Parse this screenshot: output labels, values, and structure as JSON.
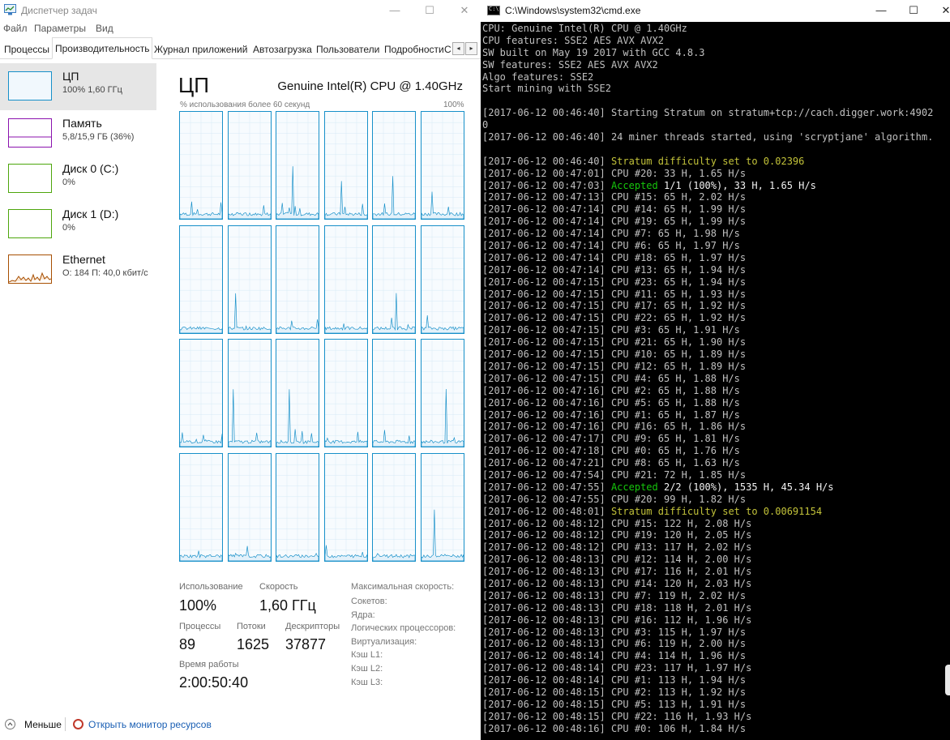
{
  "taskmanager": {
    "title": "Диспетчер задач",
    "menu": [
      "Файл",
      "Параметры",
      "Вид"
    ],
    "tabs": [
      "Процессы",
      "Производительность",
      "Журнал приложений",
      "Автозагрузка",
      "Пользователи",
      "Подробности",
      "С"
    ],
    "sidebar": [
      {
        "name": "ЦП",
        "value": "100% 1,60 ГГц",
        "color": "#1790c9"
      },
      {
        "name": "Память",
        "value": "5,8/15,9 ГБ (36%)",
        "color": "#8b12ae"
      },
      {
        "name": "Диск 0 (C:)",
        "value": "0%",
        "color": "#4da60c"
      },
      {
        "name": "Диск 1 (D:)",
        "value": "0%",
        "color": "#4da60c"
      },
      {
        "name": "Ethernet",
        "value": "О: 184 П: 40,0 кбит/с",
        "color": "#a74f01"
      }
    ],
    "cpu": {
      "title": "ЦП",
      "model": "Genuine Intel(R) CPU @ 1.40GHz",
      "graph_caption": "% использования более 60 секунд",
      "graph_max": "100%",
      "cores": 24
    },
    "stats": {
      "usage_label": "Использование",
      "usage_value": "100%",
      "speed_label": "Скорость",
      "speed_value": "1,60 ГГц",
      "processes_label": "Процессы",
      "processes_value": "89",
      "threads_label": "Потоки",
      "threads_value": "1625",
      "handles_label": "Дескрипторы",
      "handles_value": "37877",
      "uptime_label": "Время работы",
      "uptime_value": "2:00:50:40",
      "right_labels": [
        "Максимальная скорость:",
        "Сокетов:",
        "Ядра:",
        "Логических процессоров:",
        "Виртуализация:",
        "Кэш L1:",
        "Кэш L2:",
        "Кэш L3:"
      ]
    },
    "footer": {
      "less": "Меньше",
      "monitor": "Открыть монитор ресурсов"
    }
  },
  "cmd": {
    "title": "C:\\Windows\\system32\\cmd.exe",
    "lines": [
      {
        "t": "CPU: Genuine Intel(R) CPU @ 1.40GHz"
      },
      {
        "t": "CPU features: SSE2 AES AVX AVX2"
      },
      {
        "t": "SW built on May 19 2017 with GCC 4.8.3"
      },
      {
        "t": "SW features: SSE2 AES AVX AVX2"
      },
      {
        "t": "Algo features: SSE2"
      },
      {
        "t": "Start mining with SSE2"
      },
      {
        "t": ""
      },
      {
        "t": "[2017-06-12 00:46:40] Starting Stratum on stratum+tcp://cach.digger.work:4902"
      },
      {
        "t": "0"
      },
      {
        "t": "[2017-06-12 00:46:40] 24 miner threads started, using 'scryptjane' algorithm."
      },
      {
        "t": ""
      },
      {
        "t": "[2017-06-12 00:46:40] ",
        "y": "Stratum difficulty set to 0.02396"
      },
      {
        "t": "[2017-06-12 00:47:01] CPU #20: 33 H, 1.65 H/s"
      },
      {
        "t": "[2017-06-12 00:47:03] ",
        "g": "Accepted",
        "b": " 1/1 (100%), 33 H, 1.65 H/s"
      },
      {
        "t": "[2017-06-12 00:47:13] CPU #15: 65 H, 2.02 H/s"
      },
      {
        "t": "[2017-06-12 00:47:14] CPU #14: 65 H, 1.99 H/s"
      },
      {
        "t": "[2017-06-12 00:47:14] CPU #19: 65 H, 1.99 H/s"
      },
      {
        "t": "[2017-06-12 00:47:14] CPU #7: 65 H, 1.98 H/s"
      },
      {
        "t": "[2017-06-12 00:47:14] CPU #6: 65 H, 1.97 H/s"
      },
      {
        "t": "[2017-06-12 00:47:14] CPU #18: 65 H, 1.97 H/s"
      },
      {
        "t": "[2017-06-12 00:47:14] CPU #13: 65 H, 1.94 H/s"
      },
      {
        "t": "[2017-06-12 00:47:15] CPU #23: 65 H, 1.94 H/s"
      },
      {
        "t": "[2017-06-12 00:47:15] CPU #11: 65 H, 1.93 H/s"
      },
      {
        "t": "[2017-06-12 00:47:15] CPU #17: 65 H, 1.92 H/s"
      },
      {
        "t": "[2017-06-12 00:47:15] CPU #22: 65 H, 1.92 H/s"
      },
      {
        "t": "[2017-06-12 00:47:15] CPU #3: 65 H, 1.91 H/s"
      },
      {
        "t": "[2017-06-12 00:47:15] CPU #21: 65 H, 1.90 H/s"
      },
      {
        "t": "[2017-06-12 00:47:15] CPU #10: 65 H, 1.89 H/s"
      },
      {
        "t": "[2017-06-12 00:47:15] CPU #12: 65 H, 1.89 H/s"
      },
      {
        "t": "[2017-06-12 00:47:15] CPU #4: 65 H, 1.88 H/s"
      },
      {
        "t": "[2017-06-12 00:47:16] CPU #2: 65 H, 1.88 H/s"
      },
      {
        "t": "[2017-06-12 00:47:16] CPU #5: 65 H, 1.88 H/s"
      },
      {
        "t": "[2017-06-12 00:47:16] CPU #1: 65 H, 1.87 H/s"
      },
      {
        "t": "[2017-06-12 00:47:16] CPU #16: 65 H, 1.86 H/s"
      },
      {
        "t": "[2017-06-12 00:47:17] CPU #9: 65 H, 1.81 H/s"
      },
      {
        "t": "[2017-06-12 00:47:18] CPU #0: 65 H, 1.76 H/s"
      },
      {
        "t": "[2017-06-12 00:47:21] CPU #8: 65 H, 1.63 H/s"
      },
      {
        "t": "[2017-06-12 00:47:54] CPU #21: 72 H, 1.85 H/s"
      },
      {
        "t": "[2017-06-12 00:47:55] ",
        "g": "Accepted",
        "b": " 2/2 (100%), 1535 H, 45.34 H/s"
      },
      {
        "t": "[2017-06-12 00:47:55] CPU #20: 99 H, 1.82 H/s"
      },
      {
        "t": "[2017-06-12 00:48:01] ",
        "y": "Stratum difficulty set to 0.00691154"
      },
      {
        "t": "[2017-06-12 00:48:12] CPU #15: 122 H, 2.08 H/s"
      },
      {
        "t": "[2017-06-12 00:48:12] CPU #19: 120 H, 2.05 H/s"
      },
      {
        "t": "[2017-06-12 00:48:12] CPU #13: 117 H, 2.02 H/s"
      },
      {
        "t": "[2017-06-12 00:48:13] CPU #12: 114 H, 2.00 H/s"
      },
      {
        "t": "[2017-06-12 00:48:13] CPU #17: 116 H, 2.01 H/s"
      },
      {
        "t": "[2017-06-12 00:48:13] CPU #14: 120 H, 2.03 H/s"
      },
      {
        "t": "[2017-06-12 00:48:13] CPU #7: 119 H, 2.02 H/s"
      },
      {
        "t": "[2017-06-12 00:48:13] CPU #18: 118 H, 2.01 H/s"
      },
      {
        "t": "[2017-06-12 00:48:13] CPU #16: 112 H, 1.96 H/s"
      },
      {
        "t": "[2017-06-12 00:48:13] CPU #3: 115 H, 1.97 H/s"
      },
      {
        "t": "[2017-06-12 00:48:13] CPU #6: 119 H, 2.00 H/s"
      },
      {
        "t": "[2017-06-12 00:48:14] CPU #4: 114 H, 1.96 H/s"
      },
      {
        "t": "[2017-06-12 00:48:14] CPU #23: 117 H, 1.97 H/s"
      },
      {
        "t": "[2017-06-12 00:48:14] CPU #1: 113 H, 1.94 H/s"
      },
      {
        "t": "[2017-06-12 00:48:15] CPU #2: 113 H, 1.92 H/s"
      },
      {
        "t": "[2017-06-12 00:48:15] CPU #5: 113 H, 1.91 H/s"
      },
      {
        "t": "[2017-06-12 00:48:15] CPU #22: 116 H, 1.93 H/s"
      },
      {
        "t": "[2017-06-12 00:48:16] CPU #0: 106 H, 1.84 H/s"
      }
    ]
  }
}
